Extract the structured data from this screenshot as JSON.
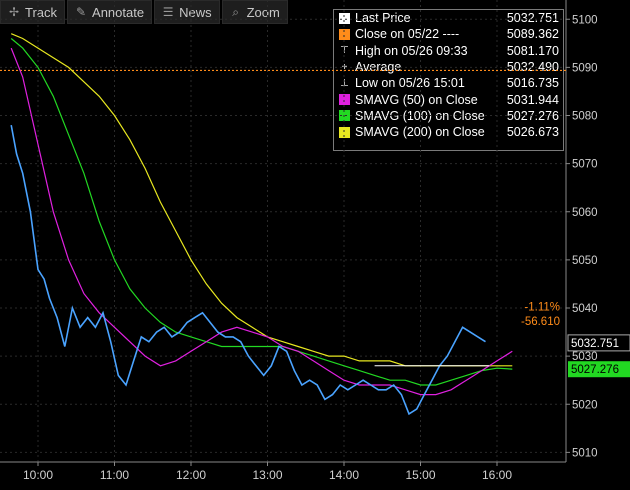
{
  "toolbar": [
    {
      "icon": "track-icon",
      "glyph": "✢",
      "label": "Track"
    },
    {
      "icon": "annotate-icon",
      "glyph": "✎",
      "label": "Annotate"
    },
    {
      "icon": "news-icon",
      "glyph": "☰",
      "label": "News"
    },
    {
      "icon": "zoom-icon",
      "glyph": "⌕",
      "label": "Zoom"
    }
  ],
  "legend": [
    {
      "label": "Last Price",
      "value": "5032.751",
      "color": "#ffffff",
      "marker": "box"
    },
    {
      "label": "Close on 05/22 ----",
      "value": "5089.362",
      "color": "#ff8c1a",
      "marker": "box"
    },
    {
      "label": "High on 05/26 09:33",
      "value": "5081.170",
      "color": "#ffffff",
      "marker": "high"
    },
    {
      "label": "Average",
      "value": "5032.490",
      "color": "#ffffff",
      "marker": "avg"
    },
    {
      "label": "Low on 05/26 15:01",
      "value": "5016.735",
      "color": "#ffffff",
      "marker": "low"
    },
    {
      "label": "SMAVG (50) on Close",
      "value": "5031.944",
      "color": "#e020e0",
      "marker": "box"
    },
    {
      "label": "SMAVG (100) on Close",
      "value": "5027.276",
      "color": "#22d822",
      "marker": "box"
    },
    {
      "label": "SMAVG (200) on Close",
      "value": "5026.673",
      "color": "#e8e820",
      "marker": "box"
    }
  ],
  "chart_data": {
    "type": "line",
    "y_ticks": [
      5010,
      5020,
      5030,
      5040,
      5050,
      5060,
      5070,
      5080,
      5090,
      5100
    ],
    "ylim": [
      5008,
      5104
    ],
    "x_ticks": [
      "10:00",
      "11:00",
      "12:00",
      "13:00",
      "14:00",
      "15:00",
      "16:00"
    ],
    "grid": true,
    "prev_close": 5089.362,
    "annotations": {
      "change_pct": "-1.11%",
      "change_abs": "-56.610",
      "last_label": "5032.751",
      "sma_label": "5027.276"
    },
    "series": [
      {
        "name": "Last Price",
        "color": "#4aa3ff",
        "x": [
          9.65,
          9.72,
          9.8,
          9.9,
          10.0,
          10.08,
          10.15,
          10.25,
          10.35,
          10.45,
          10.55,
          10.65,
          10.75,
          10.85,
          10.95,
          11.05,
          11.15,
          11.25,
          11.35,
          11.45,
          11.55,
          11.65,
          11.75,
          11.85,
          11.95,
          12.05,
          12.15,
          12.25,
          12.35,
          12.45,
          12.55,
          12.65,
          12.75,
          12.85,
          12.95,
          13.05,
          13.15,
          13.25,
          13.35,
          13.45,
          13.55,
          13.65,
          13.75,
          13.85,
          13.95,
          14.05,
          14.15,
          14.25,
          14.35,
          14.45,
          14.55,
          14.65,
          14.75,
          14.85,
          14.95,
          15.05,
          15.15,
          15.25,
          15.35,
          15.45,
          15.55,
          15.65,
          15.75,
          15.85
        ],
        "values": [
          5078,
          5072,
          5068,
          5060,
          5048,
          5046,
          5042,
          5038,
          5032,
          5040,
          5036,
          5038,
          5036,
          5039,
          5033,
          5026,
          5024,
          5029,
          5034,
          5033,
          5035,
          5036,
          5034,
          5035,
          5037,
          5038,
          5039,
          5037,
          5035,
          5034,
          5034,
          5033,
          5030,
          5028,
          5026,
          5028,
          5032,
          5031,
          5027,
          5024,
          5025,
          5024,
          5021,
          5022,
          5024,
          5023,
          5024,
          5025,
          5024,
          5023,
          5023,
          5024,
          5022,
          5018,
          5019,
          5022,
          5025,
          5028,
          5030,
          5033,
          5036,
          5035,
          5034,
          5033
        ]
      },
      {
        "name": "SMAVG (50) on Close",
        "color": "#e020e0",
        "x": [
          9.65,
          9.8,
          10.0,
          10.2,
          10.4,
          10.6,
          10.8,
          11.0,
          11.2,
          11.4,
          11.6,
          11.8,
          12.0,
          12.2,
          12.4,
          12.6,
          12.8,
          13.0,
          13.2,
          13.4,
          13.6,
          13.8,
          14.0,
          14.2,
          14.4,
          14.6,
          14.8,
          15.0,
          15.2,
          15.4,
          15.6,
          15.8,
          16.0,
          16.2
        ],
        "values": [
          5094,
          5088,
          5074,
          5060,
          5050,
          5043,
          5039,
          5036,
          5033,
          5030,
          5028,
          5029,
          5031,
          5033,
          5035,
          5036,
          5035,
          5034,
          5032,
          5031,
          5029,
          5027,
          5025,
          5024,
          5024,
          5024,
          5023,
          5022,
          5022,
          5023,
          5025,
          5027,
          5029,
          5031
        ]
      },
      {
        "name": "SMAVG (100) on Close",
        "color": "#22d822",
        "x": [
          9.65,
          9.8,
          10.0,
          10.2,
          10.4,
          10.6,
          10.8,
          11.0,
          11.2,
          11.4,
          11.6,
          11.8,
          12.0,
          12.2,
          12.4,
          12.6,
          12.8,
          13.0,
          13.2,
          13.4,
          13.6,
          13.8,
          14.0,
          14.2,
          14.4,
          14.6,
          14.8,
          15.0,
          15.2,
          15.4,
          15.6,
          15.8,
          16.0,
          16.2
        ],
        "values": [
          5096,
          5094,
          5090,
          5084,
          5076,
          5068,
          5058,
          5050,
          5044,
          5040,
          5037,
          5035,
          5034,
          5033,
          5032,
          5032,
          5032,
          5032,
          5032,
          5031,
          5030,
          5029,
          5028,
          5027,
          5026,
          5025,
          5025,
          5024,
          5024,
          5025,
          5026,
          5027,
          5027.5,
          5027.3
        ]
      },
      {
        "name": "SMAVG (200) on Close",
        "color": "#e8e820",
        "x": [
          9.65,
          9.8,
          10.0,
          10.2,
          10.4,
          10.6,
          10.8,
          11.0,
          11.2,
          11.4,
          11.6,
          11.8,
          12.0,
          12.2,
          12.4,
          12.6,
          12.8,
          13.0,
          13.2,
          13.4,
          13.6,
          13.8,
          14.0,
          14.2,
          14.4,
          14.6,
          14.8,
          15.0,
          15.2,
          15.4,
          15.6,
          15.8,
          16.0,
          16.2
        ],
        "values": [
          5097,
          5096,
          5094,
          5092,
          5090,
          5087,
          5084,
          5080,
          5075,
          5069,
          5062,
          5056,
          5050,
          5045,
          5041,
          5038,
          5036,
          5034,
          5033,
          5032,
          5031,
          5030,
          5030,
          5029,
          5029,
          5029,
          5028,
          5028,
          5028,
          5028,
          5028,
          5028,
          5028,
          5028
        ]
      }
    ]
  }
}
